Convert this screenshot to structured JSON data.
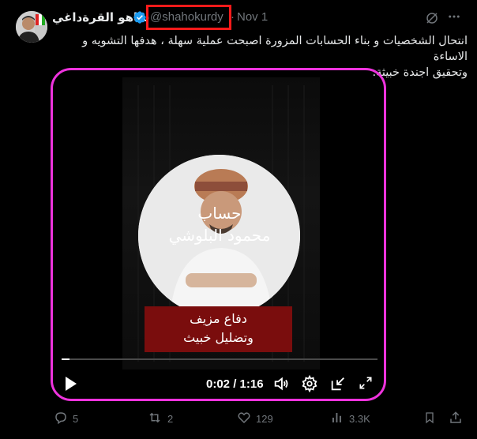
{
  "author": {
    "name": "شاهو القرةداغي",
    "handle": "@shahokurdy",
    "separator": "·",
    "date": "Nov 1"
  },
  "tweet_text_lines": [
    "انتحال الشخصيات و بناء الحسابات المزورة اصبحت عملية سهلة ، هدفها التشويه و الاساءة",
    "وتحقيق اجندة خبيثة."
  ],
  "video": {
    "caption_line1": "حساب",
    "caption_line2": "محمود البلوشي",
    "banner_line1": "دفاع مزيف",
    "banner_line2": "وتضليل خبيث",
    "time": "0:02 / 1:16",
    "progress": 0.026
  },
  "actions": {
    "replies": "5",
    "reposts": "2",
    "likes": "129",
    "views": "3.3K"
  },
  "colors": {
    "highlight_box": "#ff1a1a",
    "media_frame": "#ee33dd",
    "banner": "#7a0d0d",
    "verified": "#1d9bf0",
    "muted": "#71767b"
  },
  "icons": [
    "verified-badge-icon",
    "grok-icon",
    "more-icon",
    "play-icon",
    "volume-icon",
    "settings-icon",
    "pip-icon",
    "fullscreen-icon",
    "reply-icon",
    "repost-icon",
    "like-icon",
    "views-icon",
    "bookmark-icon",
    "share-icon"
  ]
}
